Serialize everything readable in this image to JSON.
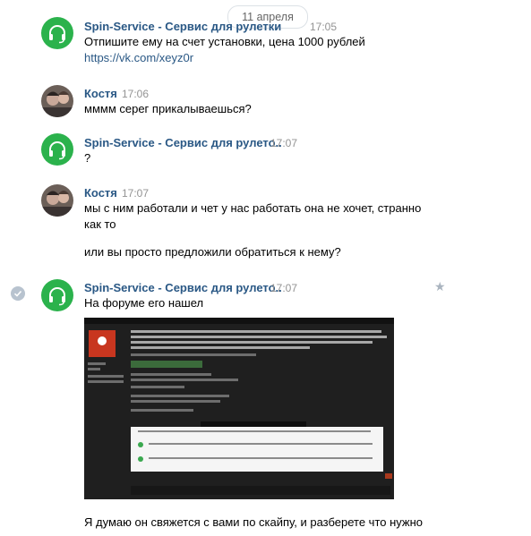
{
  "date_separator": "11 апреля",
  "messages": [
    {
      "sender": "Spin-Service - Сервис для рулетки",
      "time": "17:05",
      "lines": [
        "Отпишите ему на счет установки, цена 1000 рублей"
      ],
      "link": "https://vk.com/xeyz0r"
    },
    {
      "sender": "Костя",
      "time": "17:06",
      "lines": [
        "мммм серег прикалываешься?"
      ]
    },
    {
      "sender": "Spin-Service - Сервис для рулето..",
      "time": "17:07",
      "lines": [
        "?"
      ]
    },
    {
      "sender": "Костя",
      "time": "17:07",
      "lines": [
        "мы с ним работали и чет у нас работать она не хочет, странно",
        "как то",
        "или вы просто предложили обратиться к нему?"
      ]
    },
    {
      "sender": "Spin-Service - Сервис для рулето..",
      "time": "17:07",
      "lines": [
        "На форуме его нашел"
      ],
      "attachment": "forum-screenshot",
      "after_text": "Я думаю он свяжется с вами по скайпу, и разберете что нужно"
    }
  ],
  "icons": {
    "spin_avatar": "headset-icon",
    "read_status": "check-circle-icon",
    "favorite": "star-icon"
  },
  "colors": {
    "brand_green": "#2bb24c",
    "name_blue": "#2a5885",
    "time_gray": "#939393"
  }
}
